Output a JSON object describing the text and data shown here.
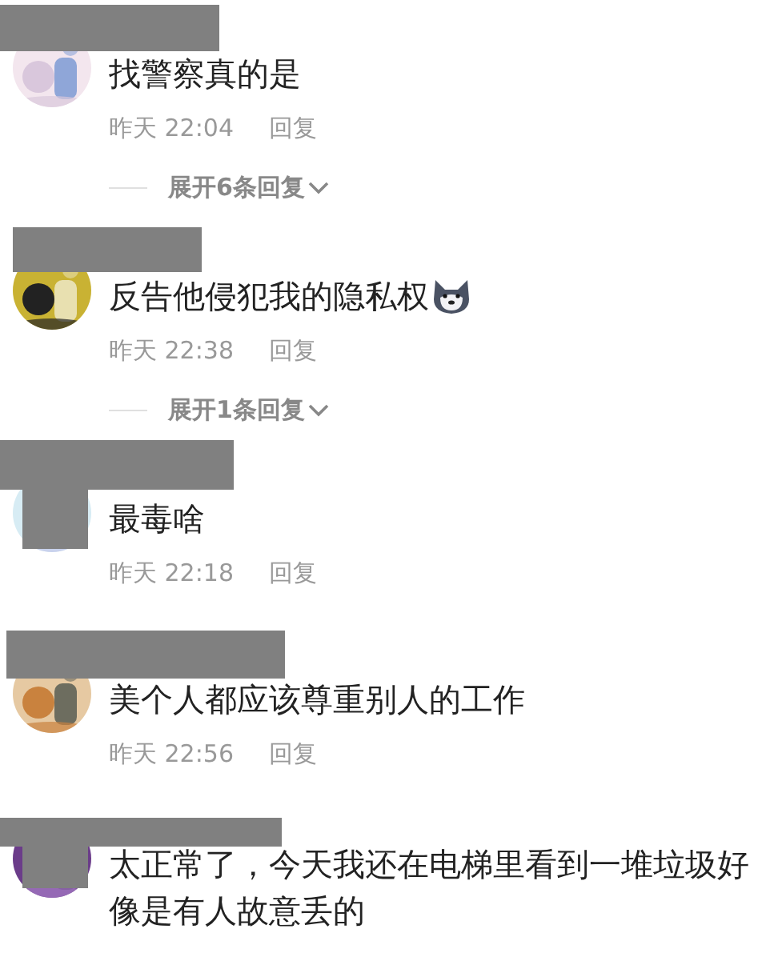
{
  "comments": [
    {
      "text": "找警察真的是",
      "emoji": false,
      "time": "昨天 22:04",
      "reply": "回复",
      "avatar_covered": false,
      "expand": "展开6条回复"
    },
    {
      "text": "反告他侵犯我的隐私权",
      "emoji": true,
      "time": "昨天 22:38",
      "reply": "回复",
      "avatar_covered": false,
      "expand": "展开1条回复"
    },
    {
      "text": "最毒啥",
      "emoji": false,
      "time": "昨天 22:18",
      "reply": "回复",
      "avatar_covered": true
    },
    {
      "text": "美个人都应该尊重别人的工作",
      "emoji": false,
      "time": "昨天 22:56",
      "reply": "回复",
      "avatar_covered": false
    },
    {
      "text": "太正常了，今天我还在电梯里看到一堆垃圾好像是有人故意丢的",
      "emoji": false,
      "avatar_covered": true
    }
  ]
}
